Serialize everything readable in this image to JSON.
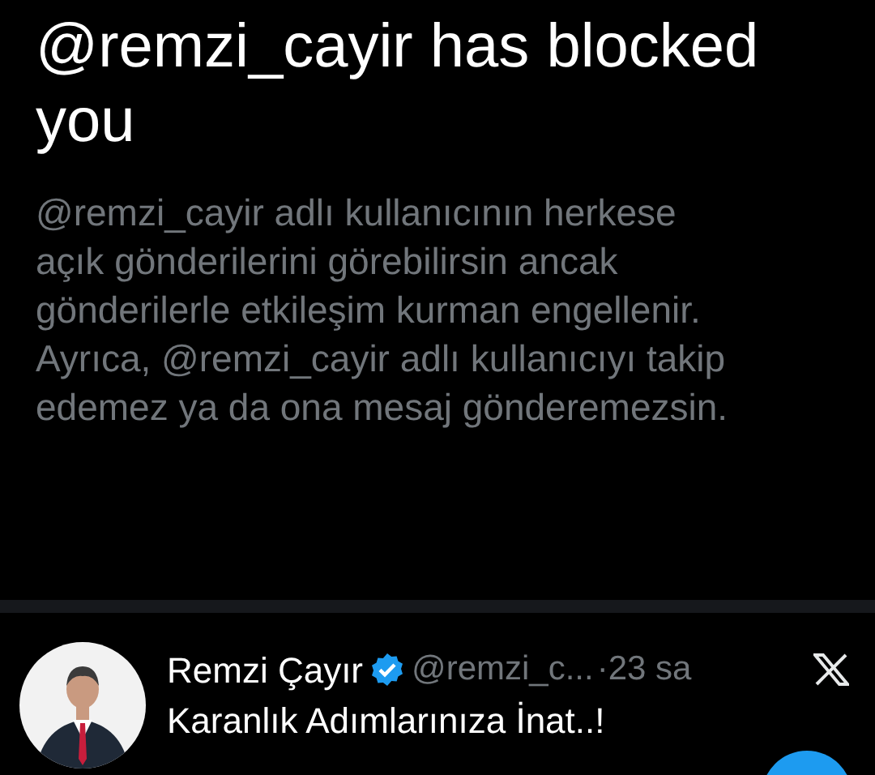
{
  "blocked_notice": {
    "title": "@remzi_cayir has blocked you",
    "body": "@remzi_cayir adlı kullanıcının herkese açık gönderilerini görebilirsin ancak gönderilerle etkileşim kurman engellenir. Ayrıca, @remzi_cayir adlı kullanıcıyı takip edemez ya da ona mesaj gönderemezsin."
  },
  "post": {
    "name": "Remzi Çayır",
    "verified": true,
    "handle": "@remzi_c...",
    "separator": "·",
    "time": "23 sa",
    "text": "Karanlık Adımlarınıza İnat..!"
  }
}
